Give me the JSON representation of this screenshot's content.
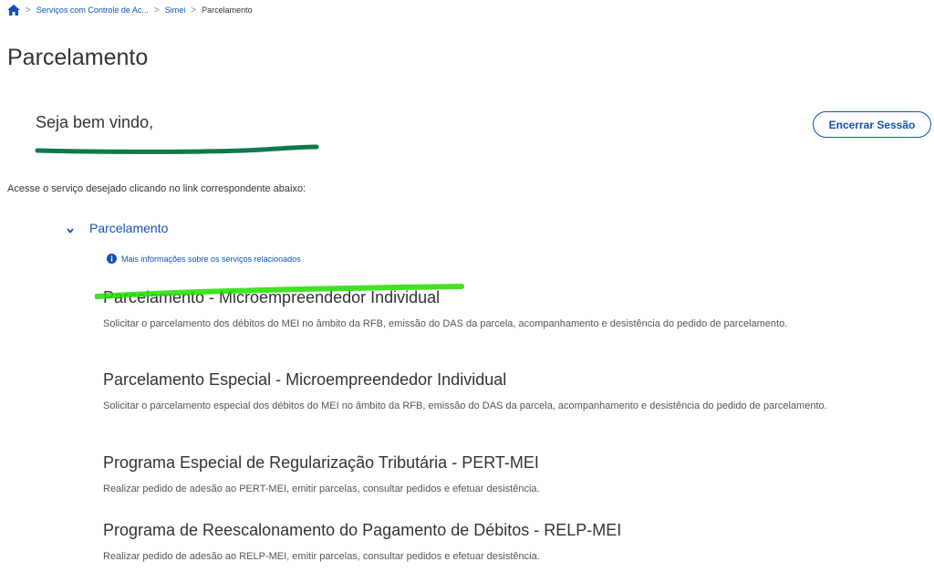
{
  "breadcrumb": {
    "items": [
      "Serviços com Controle de Ac...",
      "Simei",
      "Parcelamento"
    ]
  },
  "page": {
    "title": "Parcelamento",
    "welcome": "Seja bem vindo,",
    "logout_label": "Encerrar Sessão",
    "instructions": "Acesse o serviço desejado clicando no link correspondente abaixo:"
  },
  "section": {
    "label": "Parcelamento",
    "info_link": "Mais informações sobre os serviços relacionados"
  },
  "services": [
    {
      "title": "Parcelamento - Microempreendedor Individual",
      "desc": "Solicitar o parcelamento dos débitos do MEI no âmbito da RFB, emissão do DAS da parcela, acompanhamento e desistência do pedido de parcelamento."
    },
    {
      "title": "Parcelamento Especial - Microempreendedor Individual",
      "desc": "Solicitar o parcelamento especial dos débitos do MEI no âmbito da RFB, emissão do DAS da parcela, acompanhamento e desistência do pedido de parcelamento."
    },
    {
      "title": "Programa Especial de Regularização Tributária - PERT-MEI",
      "desc": "Realizar pedido de adesão ao PERT-MEI, emitir parcelas, consultar pedidos e efetuar desistência."
    },
    {
      "title": "Programa de Reescalonamento do Pagamento de Débitos - RELP-MEI",
      "desc": "Realizar pedido de adesão ao RELP-MEI, emitir parcelas, consultar pedidos e efetuar desistência."
    }
  ],
  "colors": {
    "link_blue": "#1351b4",
    "annotation_dark_green": "#0f7a4a",
    "annotation_bright_green": "#22dd00"
  },
  "icons": [
    "home-icon",
    "chevron-right-icon",
    "chevron-down-icon",
    "info-icon"
  ]
}
